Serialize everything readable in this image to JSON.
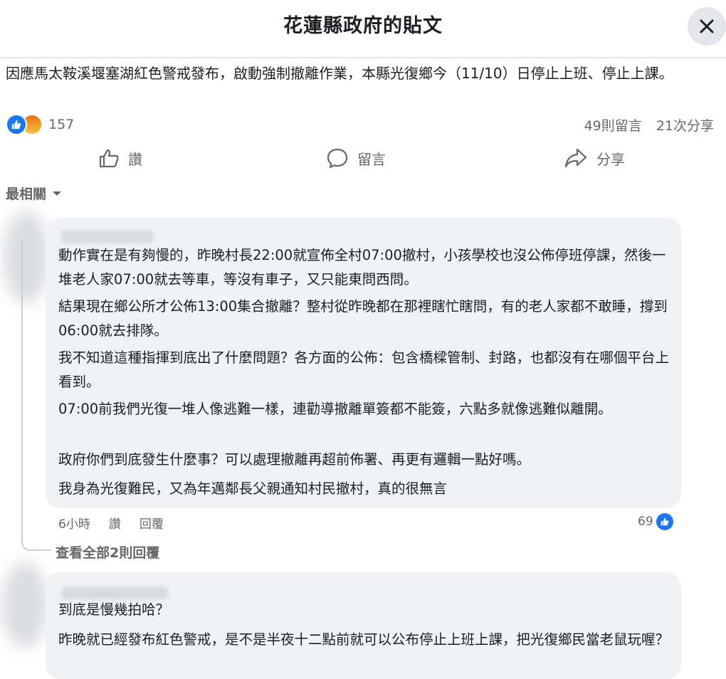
{
  "header": {
    "title": "花蓮縣政府的貼文"
  },
  "post": {
    "text": "因應馬太鞍溪堰塞湖紅色警戒發布，啟動強制撤離作業，本縣光復鄉今（11/10）日停止上班、停止上課。"
  },
  "stats": {
    "reaction_count": "157",
    "comments": "49則留言",
    "shares": "21次分享"
  },
  "actions": {
    "like": "讚",
    "comment": "留言",
    "share": "分享"
  },
  "sort": {
    "label": "最相關"
  },
  "comments": [
    {
      "paragraphs": [
        "動作實在是有夠慢的，昨晚村長22:00就宣佈全村07:00撤村，小孩學校也沒公佈停班停課，然後一堆老人家07:00就去等車，等沒有車子，又只能東問西問。",
        "結果現在鄉公所才公佈13:00集合撤離？整村從昨晚都在那裡瞎忙瞎問，有的老人家都不敢睡，撐到06:00就去排隊。",
        "我不知道這種指揮到底出了什麼問題？各方面的公佈：包含橋樑管制、封路，也都沒有在哪個平台上看到。",
        "07:00前我們光復一堆人像逃難一樣，連勸導撤離單簽都不能簽，六點多就像逃難似離開。",
        "政府你們到底發生什麼事？可以處理撤離再超前佈署、再更有邏輯一點好嗎。",
        "我身為光復難民，又為年邁鄰長父親通知村民撤村，真的很無言"
      ],
      "time": "6小時",
      "like_label": "讚",
      "reply_label": "回覆",
      "like_count": "69",
      "view_replies": "查看全部2則回覆"
    },
    {
      "paragraphs": [
        "到底是慢幾拍哈？",
        "昨晚就已經發布紅色警戒，是不是半夜十二點前就可以公布停止上班上課，把光復鄉民當老鼠玩喔？"
      ]
    }
  ],
  "icons": {
    "close": "close-icon",
    "like": "thumbs-up-icon",
    "comment": "speech-bubble-icon",
    "share": "share-arrow-icon",
    "sort": "chevron-down-icon",
    "reaction_like": "like-reaction-icon",
    "reaction_angry": "angry-reaction-icon"
  },
  "colors": {
    "brand_blue": "#1877f2",
    "secondary_text": "#65676b",
    "bubble_bg": "#f0f2f5"
  }
}
